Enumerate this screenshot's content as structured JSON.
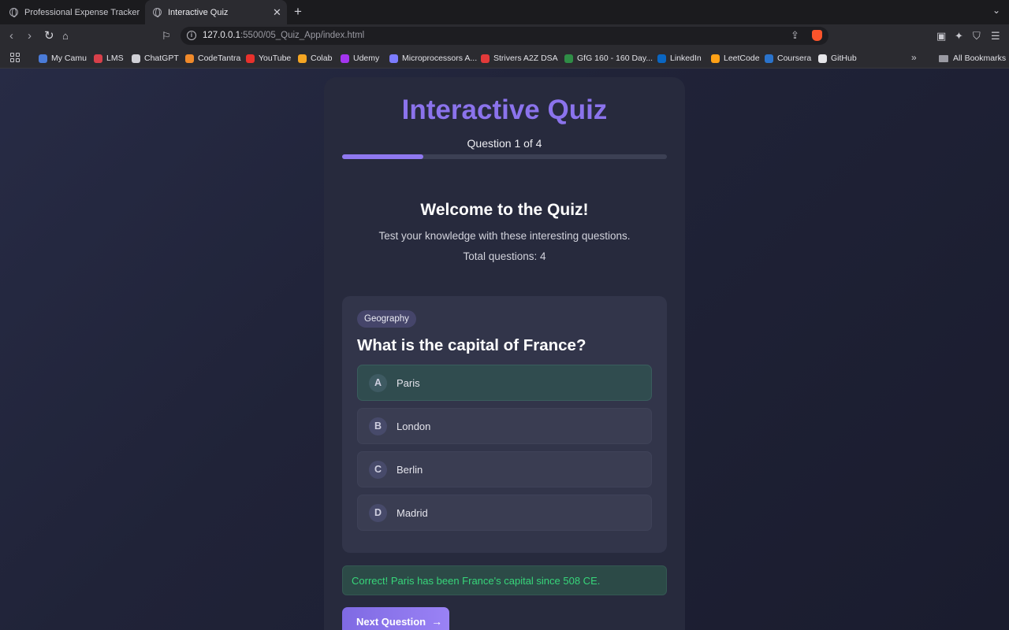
{
  "browser": {
    "tabs": [
      {
        "title": "Professional Expense Tracker",
        "active": false
      },
      {
        "title": "Interactive Quiz",
        "active": true
      }
    ],
    "url_host": "127.0.0.1",
    "url_path": ":5500/05_Quiz_App/index.html",
    "bookmarks": [
      {
        "label": "My Camu",
        "icon": "camu-icon",
        "color": "#4a7bd8"
      },
      {
        "label": "LMS",
        "icon": "lms-icon",
        "color": "#d8404a"
      },
      {
        "label": "ChatGPT",
        "icon": "chatgpt-icon",
        "color": "#d0d0d6"
      },
      {
        "label": "CodeTantra",
        "icon": "codetantra-icon",
        "color": "#f08a2a"
      },
      {
        "label": "YouTube",
        "icon": "youtube-icon",
        "color": "#e8312c"
      },
      {
        "label": "Colab",
        "icon": "colab-icon",
        "color": "#f5a623"
      },
      {
        "label": "Udemy",
        "icon": "udemy-icon",
        "color": "#a435f0"
      },
      {
        "label": "Microprocessors A...",
        "icon": "microprocessors-icon",
        "color": "#7c7cff"
      },
      {
        "label": "Strivers A2Z DSA",
        "icon": "striver-icon",
        "color": "#e23a3a"
      },
      {
        "label": "GfG 160 - 160 Day...",
        "icon": "gfg-icon",
        "color": "#2f8d46"
      },
      {
        "label": "LinkedIn",
        "icon": "linkedin-icon",
        "color": "#0a66c2"
      },
      {
        "label": "LeetCode",
        "icon": "leetcode-icon",
        "color": "#ffa116"
      },
      {
        "label": "Coursera",
        "icon": "coursera-icon",
        "color": "#2a73cc"
      },
      {
        "label": "GitHub",
        "icon": "github-icon",
        "color": "#e6e6ea"
      }
    ],
    "all_bookmarks": "All Bookmarks"
  },
  "quiz": {
    "title": "Interactive Quiz",
    "counter": "Question 1 of 4",
    "progress": 0.25,
    "welcome_title": "Welcome to the Quiz!",
    "welcome_text": "Test your knowledge with these interesting questions.",
    "total_text": "Total questions: 4",
    "category": "Geography",
    "question": "What is the capital of France?",
    "options": [
      {
        "letter": "A",
        "text": "Paris",
        "state": "correct"
      },
      {
        "letter": "B",
        "text": "London",
        "state": "default"
      },
      {
        "letter": "C",
        "text": "Berlin",
        "state": "default"
      },
      {
        "letter": "D",
        "text": "Madrid",
        "state": "default"
      }
    ],
    "feedback": "Correct! Paris has been France's capital since 508 CE.",
    "next_label": "Next Question",
    "colors": {
      "accent": "#8b73ec",
      "correct": "#37d67a"
    }
  }
}
